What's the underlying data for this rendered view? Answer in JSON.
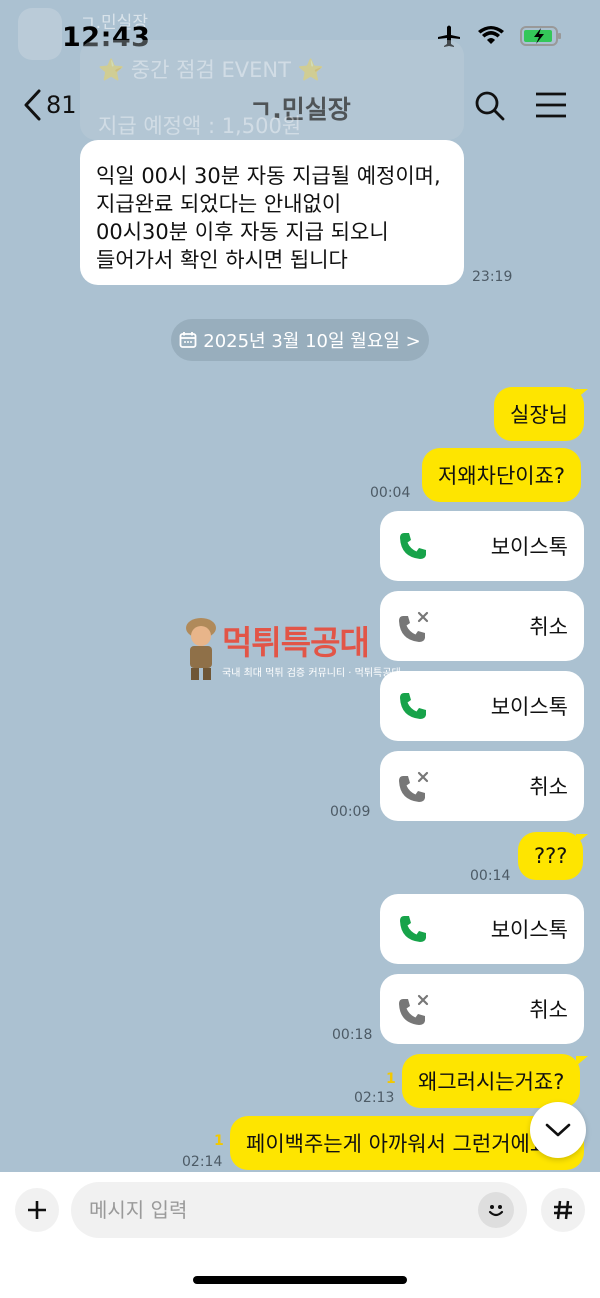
{
  "status": {
    "time": "12:43"
  },
  "header": {
    "back_count": "81",
    "title": "ㄱ.민실장"
  },
  "pinned_ghost": {
    "name": "ㄱ.민실장",
    "line1": "⭐ 중간 점검 EVENT ⭐",
    "line2": "지급 예정액 : 1,500원"
  },
  "first_message": {
    "lines": [
      "익일 00시 30분 자동 지급될 예정이며,",
      "지급완료 되었다는 안내없이",
      "00시30분 이후 자동 지급 되오니",
      "들어가서 확인 하시면 됩니다"
    ],
    "time": "23:19"
  },
  "date_divider": "2025년 3월 10일 월요일 >",
  "messages": {
    "m1": {
      "text": "실장님"
    },
    "m2": {
      "text": "저왜차단이죠?",
      "time": "00:04"
    },
    "c1": {
      "label": "보이스톡"
    },
    "c2": {
      "label": "취소"
    },
    "c3": {
      "label": "보이스톡"
    },
    "c4": {
      "label": "취소",
      "time": "00:09"
    },
    "m3": {
      "text": "???",
      "time": "00:14"
    },
    "c5": {
      "label": "보이스톡"
    },
    "c6": {
      "label": "취소",
      "time": "00:18"
    },
    "m4": {
      "text": "왜그러시는거죠?",
      "time": "02:13",
      "unread": "1"
    },
    "m5": {
      "text": "페이백주는게 아까워서 그런거에요?",
      "time": "02:14",
      "unread": "1"
    }
  },
  "watermark": {
    "title": "먹튀특공대",
    "subtitle": "국내 최대 먹튀 검증 커뮤니티 · 먹튀특공대"
  },
  "input": {
    "placeholder": "메시지 입력"
  },
  "colors": {
    "background": "#abc1d1",
    "my_bubble": "#fee500",
    "call_green": "#17a34a"
  }
}
